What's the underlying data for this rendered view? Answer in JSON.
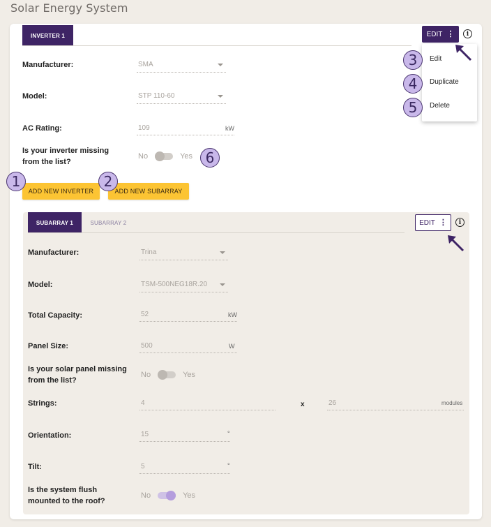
{
  "page": {
    "title": "Solar Energy System"
  },
  "inverter": {
    "tab_label": "INVERTER 1",
    "edit_label": "EDIT",
    "edit_dots": "⋮",
    "info": "i",
    "fields": {
      "manufacturer_label": "Manufacturer:",
      "manufacturer_value": "SMA",
      "model_label": "Model:",
      "model_value": "STP 110-60",
      "ac_rating_label": "AC Rating:",
      "ac_rating_value": "109",
      "ac_rating_unit": "kW",
      "missing_label": "Is your inverter missing from the list?",
      "missing_no": "No",
      "missing_yes": "Yes"
    },
    "add_inverter_label": "ADD NEW INVERTER",
    "add_subarray_label": "ADD NEW SUBARRAY"
  },
  "menu": {
    "items": [
      "Edit",
      "Duplicate",
      "Delete"
    ]
  },
  "subarray": {
    "tabs": [
      "SUBARRAY 1",
      "SUBARRAY 2"
    ],
    "edit_label": "EDIT",
    "edit_dots": "⋮",
    "info": "i",
    "fields": {
      "manufacturer_label": "Manufacturer:",
      "manufacturer_value": "Trina",
      "model_label": "Model:",
      "model_value": "TSM-500NEG18R.20",
      "capacity_label": "Total Capacity:",
      "capacity_value": "52",
      "capacity_unit": "kW",
      "panel_size_label": "Panel Size:",
      "panel_size_value": "500",
      "panel_size_unit": "W",
      "panel_missing_label": "Is your solar panel missing from the list?",
      "panel_missing_no": "No",
      "panel_missing_yes": "Yes",
      "strings_label": "Strings:",
      "strings_value": "4",
      "strings_x": "x",
      "modules_value": "26",
      "modules_unit": "modules",
      "orientation_label": "Orientation:",
      "orientation_value": "15",
      "orientation_unit": "°",
      "tilt_label": "Tilt:",
      "tilt_value": "5",
      "tilt_unit": "°",
      "flush_label": "Is the system flush mounted to the roof?",
      "flush_no": "No",
      "flush_yes": "Yes"
    }
  },
  "annotations": [
    "1",
    "2",
    "3",
    "4",
    "5",
    "6"
  ],
  "colors": {
    "brand_purple": "#3e2465",
    "accent_yellow": "#fcc433",
    "annotation_fill": "#c9b8ea"
  }
}
